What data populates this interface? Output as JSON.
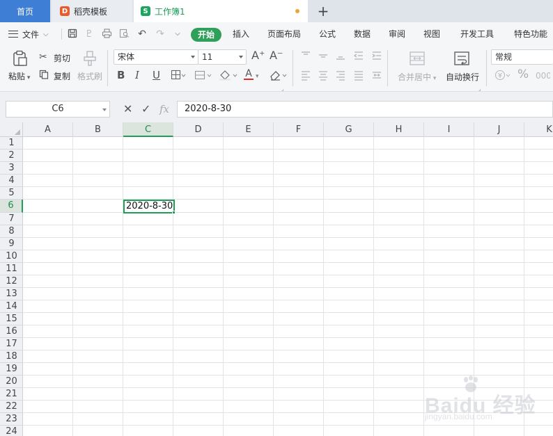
{
  "tabs": {
    "home": "首页",
    "template": "稻壳模板",
    "document": "工作簿1",
    "template_logo": "D",
    "document_logo": "S",
    "add": "+"
  },
  "menu": {
    "file": "文件",
    "items": [
      "开始",
      "插入",
      "页面布局",
      "公式",
      "数据",
      "审阅",
      "视图",
      "开发工具",
      "特色功能"
    ]
  },
  "ribbon": {
    "paste": "粘贴",
    "cut": "剪切",
    "copy": "复制",
    "format_painter": "格式刷",
    "font_name": "宋体",
    "font_size": "11",
    "bold": "B",
    "italic": "I",
    "underline": "U",
    "font_color": "A",
    "increase_font": "A⁺",
    "decrease_font": "A⁻",
    "merge_center": "合并居中",
    "wrap_text": "自动换行",
    "number_format": "常规",
    "percent": "%"
  },
  "formula_bar": {
    "name_box": "C6",
    "cancel": "✕",
    "confirm": "✓",
    "fx": "fx",
    "value": "2020-8-30"
  },
  "grid": {
    "columns": [
      "A",
      "B",
      "C",
      "D",
      "E",
      "F",
      "G",
      "H",
      "I",
      "J",
      "K"
    ],
    "rows": [
      "1",
      "2",
      "3",
      "4",
      "5",
      "6",
      "7",
      "8",
      "9",
      "10",
      "11",
      "12",
      "13",
      "14",
      "15",
      "16",
      "17",
      "18",
      "19",
      "20",
      "21",
      "22",
      "23",
      "24"
    ],
    "active_column": "C",
    "active_row": "6",
    "active_cell_value": "2020-8-30"
  },
  "watermark": {
    "main": "Baidu 经验",
    "sub": "jingyan.baidu.com"
  },
  "colors": {
    "accent_green": "#1f9c55",
    "home_tab_blue": "#3e7ed4",
    "start_pill": "#2fa05a"
  }
}
